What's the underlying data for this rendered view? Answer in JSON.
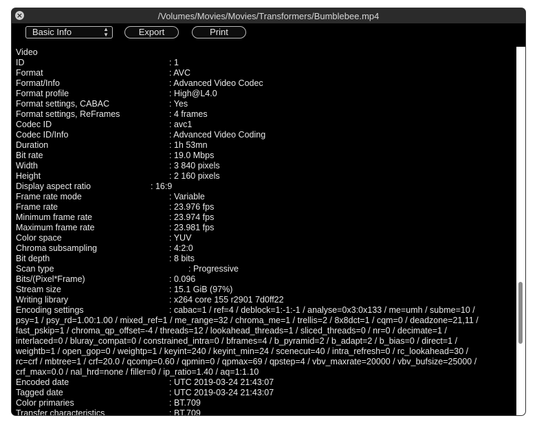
{
  "window": {
    "title": "/Volumes/Movies/Movies/Transformers/Bumblebee.mp4"
  },
  "toolbar": {
    "view_select": "Basic Info",
    "export_label": "Export",
    "print_label": "Print"
  },
  "content": {
    "section": "Video",
    "rows": [
      {
        "label": "ID",
        "value": ": 1"
      },
      {
        "label": "Format",
        "value": ": AVC"
      },
      {
        "label": "Format/Info",
        "value": ": Advanced Video Codec"
      },
      {
        "label": "Format profile",
        "value": ": High@L4.0"
      },
      {
        "label": "Format settings, CABAC",
        "value": ": Yes"
      },
      {
        "label": "Format settings, ReFrames",
        "value": ": 4 frames"
      },
      {
        "label": "Codec ID",
        "value": ": avc1"
      },
      {
        "label": "Codec ID/Info",
        "value": ": Advanced Video Coding"
      },
      {
        "label": "Duration",
        "value": ": 1h 53mn"
      },
      {
        "label": "Bit rate",
        "value": ": 19.0 Mbps"
      },
      {
        "label": "Width",
        "value": ": 3 840 pixels"
      },
      {
        "label": "Height",
        "value": ": 2 160 pixels"
      },
      {
        "label": "Display aspect ratio",
        "value": ": 16:9"
      },
      {
        "label": "Frame rate mode",
        "value": ": Variable"
      },
      {
        "label": "Frame rate",
        "value": ": 23.976 fps"
      },
      {
        "label": "Minimum frame rate",
        "value": ": 23.974 fps"
      },
      {
        "label": "Maximum frame rate",
        "value": ": 23.981 fps"
      },
      {
        "label": "Color space",
        "value": ": YUV"
      },
      {
        "label": "Chroma subsampling",
        "value": ": 4:2:0"
      },
      {
        "label": "Bit depth",
        "value": ": 8 bits"
      },
      {
        "label": "Scan type",
        "value": ": Progressive"
      },
      {
        "label": "Bits/(Pixel*Frame)",
        "value": ": 0.096"
      },
      {
        "label": "Stream size",
        "value": ": 15.1 GiB (97%)"
      },
      {
        "label": "Writing library",
        "value": ": x264 core 155 r2901 7d0ff22"
      },
      {
        "label": "Encoding settings",
        "value": ": cabac=1 / ref=4 / deblock=1:-1:-1 / analyse=0x3:0x133 / me=umh / subme=10 /"
      }
    ],
    "encoding_continuation": [
      "psy=1 / psy_rd=1.00:1.00 / mixed_ref=1 / me_range=32 / chroma_me=1 / trellis=2 / 8x8dct=1 / cqm=0 / deadzone=21,11 /",
      "fast_pskip=1 / chroma_qp_offset=-4 / threads=12 / lookahead_threads=1 / sliced_threads=0 / nr=0 / decimate=1 /",
      "interlaced=0 / bluray_compat=0 / constrained_intra=0 / bframes=4 / b_pyramid=2 / b_adapt=2 / b_bias=0 / direct=1 /",
      "weightb=1 / open_gop=0 / weightp=1 / keyint=240 / keyint_min=24 / scenecut=40 / intra_refresh=0 / rc_lookahead=30 /",
      "rc=crf / mbtree=1 / crf=20.0 / qcomp=0.60 / qpmin=0 / qpmax=69 / qpstep=4 / vbv_maxrate=20000 / vbv_bufsize=25000 /",
      "crf_max=0.0 / nal_hrd=none / filler=0 / ip_ratio=1.40 / aq=1:1.10"
    ],
    "rows_after": [
      {
        "label": "Encoded date",
        "value": ": UTC 2019-03-24 21:43:07"
      },
      {
        "label": "Tagged date",
        "value": ": UTC 2019-03-24 21:43:07"
      },
      {
        "label": "Color primaries",
        "value": ": BT.709"
      },
      {
        "label": "Transfer characteristics",
        "value": ": BT.709"
      }
    ]
  }
}
